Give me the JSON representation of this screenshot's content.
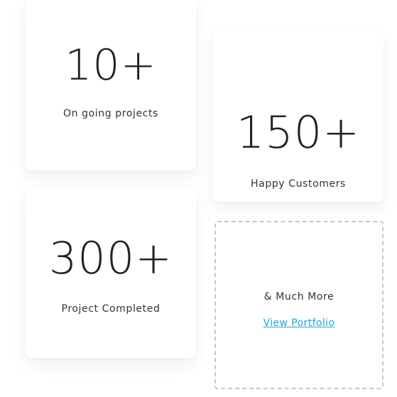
{
  "stats": [
    {
      "value": "10+",
      "label": "On going projects"
    },
    {
      "value": "150+",
      "label": "Happy Customers"
    },
    {
      "value": "300+",
      "label": "Project Completed"
    }
  ],
  "more": {
    "text": "& Much More",
    "link_label": "View Portfolio"
  },
  "colors": {
    "accent_link": "#1aa7e0",
    "text": "#222222",
    "dashed_border": "#c8c8c8"
  }
}
